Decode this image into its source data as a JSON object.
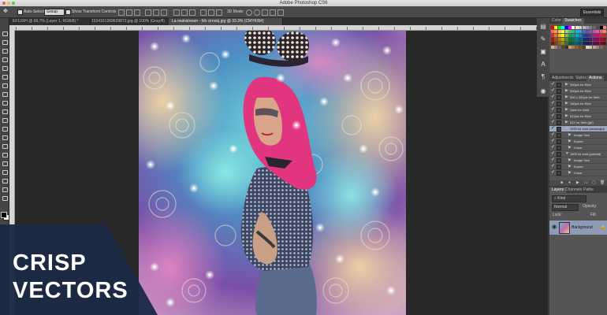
{
  "window": {
    "title": "Adobe Photoshop CS6"
  },
  "options_bar": {
    "auto_select_label": "Auto-Select:",
    "auto_select_value": "Group",
    "show_transform_label": "Show Transform Controls",
    "workspace": "Essentials"
  },
  "tabs": [
    {
      "label": "EF13XH @ 66.7% (Layer 1, RGB/8) *"
    },
    {
      "label": "1534161269639873.jpg @ 100% (Gray/8)"
    },
    {
      "label": "La mainstream - fvb cirnoiq.jpg @ 33.3% (CMYK/8#)"
    }
  ],
  "color_panel": {
    "tabs": [
      "Color",
      "Swatches"
    ]
  },
  "actions_panel": {
    "tabs": [
      "Adjustments",
      "Styles",
      "Actions"
    ],
    "rows": [
      {
        "label": "350pix for Web"
      },
      {
        "label": "550pix for Web"
      },
      {
        "label": "550 x 350pix for Web"
      },
      {
        "label": "180pix for Web"
      },
      {
        "label": "Save for Web"
      },
      {
        "label": "512pix for Web"
      },
      {
        "label": "512 for Web (gif)"
      },
      {
        "label": "1920 for web (landscape)"
      },
      {
        "label": "Image Size"
      },
      {
        "label": "Export"
      },
      {
        "label": "Close"
      },
      {
        "label": "1800 for web (portrait)"
      },
      {
        "label": "Image Size"
      },
      {
        "label": "Export"
      },
      {
        "label": "Close"
      }
    ]
  },
  "layers_panel": {
    "tabs": [
      "Layers",
      "Channels",
      "Paths"
    ],
    "kind_label": "Kind",
    "blend_mode": "Normal",
    "opacity_label": "Opacity:",
    "fill_label": "Fill:",
    "lock_label": "Lock:",
    "layer_name": "Background"
  },
  "overlay": {
    "line1": "CRISP",
    "line2": "VECTORS",
    "bg_color": "#1c2a45"
  },
  "colors": {
    "panel": "#555555",
    "workspace": "#282828",
    "highlight": "#9aa6bd"
  }
}
